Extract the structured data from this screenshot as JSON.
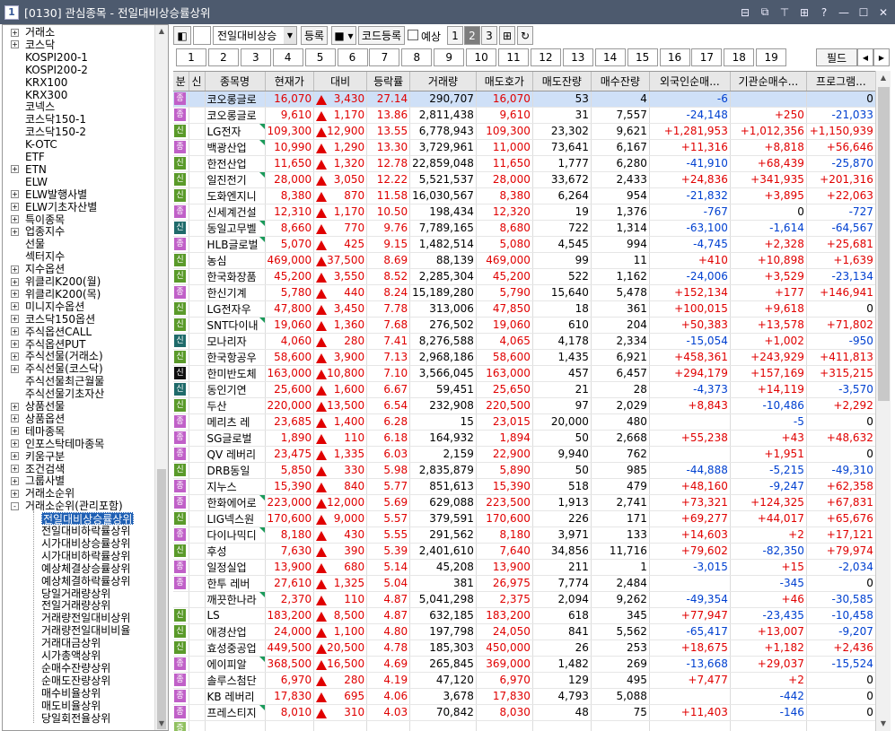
{
  "window": {
    "icon": "1",
    "title": "[0130] 관심종목 - 전일대비상승률상위"
  },
  "tree": [
    {
      "label": "거래소",
      "exp": "+"
    },
    {
      "label": "코스닥",
      "exp": "+"
    },
    {
      "label": "KOSPI200-1"
    },
    {
      "label": "KOSPI200-2"
    },
    {
      "label": "KRX100"
    },
    {
      "label": "KRX300"
    },
    {
      "label": "코넥스"
    },
    {
      "label": "코스닥150-1"
    },
    {
      "label": "코스닥150-2"
    },
    {
      "label": "K-OTC"
    },
    {
      "label": "ETF"
    },
    {
      "label": "ETN",
      "exp": "+"
    },
    {
      "label": "ELW"
    },
    {
      "label": "ELW발행사별",
      "exp": "+"
    },
    {
      "label": "ELW기초자산별",
      "exp": "+"
    },
    {
      "label": "특이종목",
      "exp": "+"
    },
    {
      "label": "업종지수",
      "exp": "+"
    },
    {
      "label": "선물"
    },
    {
      "label": "섹터지수"
    },
    {
      "label": "지수옵션",
      "exp": "+"
    },
    {
      "label": "위클리K200(월)",
      "exp": "+"
    },
    {
      "label": "위클리K200(목)",
      "exp": "+"
    },
    {
      "label": "미니지수옵션",
      "exp": "+"
    },
    {
      "label": "코스닥150옵션",
      "exp": "+"
    },
    {
      "label": "주식옵션CALL",
      "exp": "+"
    },
    {
      "label": "주식옵션PUT",
      "exp": "+"
    },
    {
      "label": "주식선물(거래소)",
      "exp": "+"
    },
    {
      "label": "주식선물(코스닥)",
      "exp": "+"
    },
    {
      "label": "주식선물최근월물"
    },
    {
      "label": "주식선물기초자산"
    },
    {
      "label": "상품선물",
      "exp": "+"
    },
    {
      "label": "상품옵션",
      "exp": "+"
    },
    {
      "label": "테마종목",
      "exp": "+"
    },
    {
      "label": "인포스탁테마종목",
      "exp": "+"
    },
    {
      "label": "키움구분",
      "exp": "+"
    },
    {
      "label": "조건검색",
      "exp": "+"
    },
    {
      "label": "그룹사별",
      "exp": "+"
    },
    {
      "label": "거래소순위",
      "exp": "+"
    },
    {
      "label": "거래소순위(관리포함)",
      "exp": "-"
    },
    {
      "label": "전일대비상승률상위",
      "child": true,
      "selected": true
    },
    {
      "label": "전일대비하락률상위",
      "child": true
    },
    {
      "label": "시가대비상승률상위",
      "child": true
    },
    {
      "label": "시가대비하락률상위",
      "child": true
    },
    {
      "label": "예상체결상승률상위",
      "child": true
    },
    {
      "label": "예상체결하락률상위",
      "child": true
    },
    {
      "label": "당일거래량상위",
      "child": true
    },
    {
      "label": "전일거래량상위",
      "child": true
    },
    {
      "label": "거래량전일대비상위",
      "child": true
    },
    {
      "label": "거래량전일대비비율",
      "child": true
    },
    {
      "label": "거래대금상위",
      "child": true
    },
    {
      "label": "시가총액상위",
      "child": true
    },
    {
      "label": "순매수잔량상위",
      "child": true
    },
    {
      "label": "순매도잔량상위",
      "child": true
    },
    {
      "label": "매수비율상위",
      "child": true
    },
    {
      "label": "매도비율상위",
      "child": true
    },
    {
      "label": "당일회전율상위",
      "child": true
    }
  ],
  "toolbar": {
    "group_select": "전일대비상승",
    "register": "등록",
    "code_register": "코드등록",
    "expected_label": "예상",
    "pages": [
      "1",
      "2",
      "3"
    ],
    "current_page": "2"
  },
  "num_tabs": [
    "1",
    "2",
    "3",
    "4",
    "5",
    "6",
    "7",
    "8",
    "9",
    "10",
    "11",
    "12",
    "13",
    "14",
    "15",
    "16",
    "17",
    "18",
    "19"
  ],
  "field_button": "필드",
  "columns": [
    "분",
    "신",
    "종목명",
    "현재가",
    "대비",
    "등락률",
    "거래량",
    "매도호가",
    "매도잔량",
    "매수잔량",
    "외국인순매...",
    "기관순매수...",
    "프로그램..."
  ],
  "tag_colors": {
    "종": "#c060c8",
    "신": "#5a9a2a",
    "신D": "#1f6a6a",
    "신B": "#101010",
    "증": "#90c060"
  },
  "rows": [
    {
      "t": "종",
      "n": "코오롱글로",
      "p": "16,070",
      "d": "3,430",
      "up": true,
      "r": "27.14",
      "v": "290,707",
      "a": "16,070",
      "as": "53",
      "bs": "4",
      "f": "-6",
      "i": "",
      "g": "0",
      "hl": true
    },
    {
      "t": "종",
      "n": "코오롱글로",
      "p": "9,610",
      "d": "1,170",
      "r": "13.86",
      "v": "2,811,438",
      "a": "9,610",
      "as": "31",
      "bs": "7,557",
      "f": "-24,148",
      "i": "+250",
      "g": "-21,033"
    },
    {
      "t": "신",
      "n": "LG전자",
      "p": "109,300",
      "d": "12,900",
      "r": "13.55",
      "v": "6,778,943",
      "a": "109,300",
      "as": "23,302",
      "bs": "9,621",
      "f": "+1,281,953",
      "i": "+1,012,356",
      "g": "+1,150,939",
      "c": true
    },
    {
      "t": "종",
      "n": "백광산업",
      "p": "10,990",
      "d": "1,290",
      "r": "13.30",
      "v": "3,729,961",
      "a": "11,000",
      "as": "73,641",
      "bs": "6,167",
      "f": "+11,316",
      "i": "+8,818",
      "g": "+56,646",
      "c": true
    },
    {
      "t": "신",
      "n": "한전산업",
      "p": "11,650",
      "d": "1,320",
      "r": "12.78",
      "v": "22,859,048",
      "a": "11,650",
      "as": "1,777",
      "bs": "6,280",
      "f": "-41,910",
      "i": "+68,439",
      "g": "-25,870"
    },
    {
      "t": "신",
      "n": "일진전기",
      "p": "28,000",
      "d": "3,050",
      "r": "12.22",
      "v": "5,521,537",
      "a": "28,000",
      "as": "33,672",
      "bs": "2,433",
      "f": "+24,836",
      "i": "+341,935",
      "g": "+201,316",
      "c": true
    },
    {
      "t": "신",
      "n": "도화엔지니",
      "p": "8,380",
      "d": "870",
      "r": "11.58",
      "v": "16,030,567",
      "a": "8,380",
      "as": "6,264",
      "bs": "954",
      "f": "-21,832",
      "i": "+3,895",
      "g": "+22,063"
    },
    {
      "t": "종",
      "n": "신세계건설",
      "p": "12,310",
      "d": "1,170",
      "r": "10.50",
      "v": "198,434",
      "a": "12,320",
      "as": "19",
      "bs": "1,376",
      "f": "-767",
      "i": "0",
      "g": "-727"
    },
    {
      "t": "신D",
      "n": "동일고무벨",
      "p": "8,660",
      "d": "770",
      "r": "9.76",
      "v": "7,789,165",
      "a": "8,680",
      "as": "722",
      "bs": "1,314",
      "f": "-63,100",
      "i": "-1,614",
      "g": "-64,567",
      "c": true
    },
    {
      "t": "종",
      "n": "HLB글로벌",
      "p": "5,070",
      "d": "425",
      "r": "9.15",
      "v": "1,482,514",
      "a": "5,080",
      "as": "4,545",
      "bs": "994",
      "f": "-4,745",
      "i": "+2,328",
      "g": "+25,681",
      "c": true
    },
    {
      "t": "신",
      "n": "농심",
      "p": "469,000",
      "d": "37,500",
      "r": "8.69",
      "v": "88,139",
      "a": "469,000",
      "as": "99",
      "bs": "11",
      "f": "+410",
      "i": "+10,898",
      "g": "+1,639"
    },
    {
      "t": "신",
      "n": "한국화장품",
      "p": "45,200",
      "d": "3,550",
      "r": "8.52",
      "v": "2,285,304",
      "a": "45,200",
      "as": "522",
      "bs": "1,162",
      "f": "-24,006",
      "i": "+3,529",
      "g": "-23,134"
    },
    {
      "t": "종",
      "n": "한신기계",
      "p": "5,780",
      "d": "440",
      "r": "8.24",
      "v": "15,189,280",
      "a": "5,790",
      "as": "15,640",
      "bs": "5,478",
      "f": "+152,134",
      "i": "+177",
      "g": "+146,941"
    },
    {
      "t": "신",
      "n": "LG전자우",
      "p": "47,800",
      "d": "3,450",
      "r": "7.78",
      "v": "313,006",
      "a": "47,850",
      "as": "18",
      "bs": "361",
      "f": "+100,015",
      "i": "+9,618",
      "g": "0"
    },
    {
      "t": "신",
      "n": "SNT다이내",
      "p": "19,060",
      "d": "1,360",
      "r": "7.68",
      "v": "276,502",
      "a": "19,060",
      "as": "610",
      "bs": "204",
      "f": "+50,383",
      "i": "+13,578",
      "g": "+71,802",
      "c": true
    },
    {
      "t": "신D",
      "n": "모나리자",
      "p": "4,060",
      "d": "280",
      "r": "7.41",
      "v": "8,276,588",
      "a": "4,065",
      "as": "4,178",
      "bs": "2,334",
      "f": "-15,054",
      "i": "+1,002",
      "g": "-950"
    },
    {
      "t": "신",
      "n": "한국항공우",
      "p": "58,600",
      "d": "3,900",
      "r": "7.13",
      "v": "2,968,186",
      "a": "58,600",
      "as": "1,435",
      "bs": "6,921",
      "f": "+458,361",
      "i": "+243,929",
      "g": "+411,813"
    },
    {
      "t": "신B",
      "n": "한미반도체",
      "p": "163,000",
      "d": "10,800",
      "r": "7.10",
      "v": "3,566,045",
      "a": "163,000",
      "as": "457",
      "bs": "6,457",
      "f": "+294,179",
      "i": "+157,169",
      "g": "+315,215"
    },
    {
      "t": "신D",
      "n": "동인기연",
      "p": "25,600",
      "d": "1,600",
      "r": "6.67",
      "v": "59,451",
      "a": "25,650",
      "as": "21",
      "bs": "28",
      "f": "-4,373",
      "i": "+14,119",
      "g": "-3,570"
    },
    {
      "t": "신",
      "n": "두산",
      "p": "220,000",
      "d": "13,500",
      "r": "6.54",
      "v": "232,908",
      "a": "220,500",
      "as": "97",
      "bs": "2,029",
      "f": "+8,843",
      "i": "-10,486",
      "g": "+2,292"
    },
    {
      "t": "종",
      "n": "메리츠 레",
      "p": "23,685",
      "d": "1,400",
      "r": "6.28",
      "v": "15",
      "a": "23,015",
      "as": "20,000",
      "bs": "480",
      "f": "",
      "i": "-5",
      "g": "0"
    },
    {
      "t": "종",
      "n": "SG글로벌",
      "p": "1,890",
      "d": "110",
      "r": "6.18",
      "v": "164,932",
      "a": "1,894",
      "as": "50",
      "bs": "2,668",
      "f": "+55,238",
      "i": "+43",
      "g": "+48,632"
    },
    {
      "t": "종",
      "n": "QV 레버리",
      "p": "23,475",
      "d": "1,335",
      "r": "6.03",
      "v": "2,159",
      "a": "22,900",
      "as": "9,940",
      "bs": "762",
      "f": "",
      "i": "+1,951",
      "g": "0"
    },
    {
      "t": "신",
      "n": "DRB동일",
      "p": "5,850",
      "d": "330",
      "r": "5.98",
      "v": "2,835,879",
      "a": "5,890",
      "as": "50",
      "bs": "985",
      "f": "-44,888",
      "i": "-5,215",
      "g": "-49,310"
    },
    {
      "t": "종",
      "n": "지누스",
      "p": "15,390",
      "d": "840",
      "r": "5.77",
      "v": "851,613",
      "a": "15,390",
      "as": "518",
      "bs": "479",
      "f": "+48,160",
      "i": "-9,247",
      "g": "+62,358"
    },
    {
      "t": "종",
      "n": "한화에어로",
      "p": "223,000",
      "d": "12,000",
      "r": "5.69",
      "v": "629,088",
      "a": "223,500",
      "as": "1,913",
      "bs": "2,741",
      "f": "+73,321",
      "i": "+124,325",
      "g": "+67,831",
      "c": true
    },
    {
      "t": "신",
      "n": "LIG넥스원",
      "p": "170,600",
      "d": "9,000",
      "r": "5.57",
      "v": "379,591",
      "a": "170,600",
      "as": "226",
      "bs": "171",
      "f": "+69,277",
      "i": "+44,017",
      "g": "+65,676"
    },
    {
      "t": "종",
      "n": "다이나믹디",
      "p": "8,180",
      "d": "430",
      "r": "5.55",
      "v": "291,562",
      "a": "8,180",
      "as": "3,971",
      "bs": "133",
      "f": "+14,603",
      "i": "+2",
      "g": "+17,121",
      "c": true
    },
    {
      "t": "신",
      "n": "후성",
      "p": "7,630",
      "d": "390",
      "r": "5.39",
      "v": "2,401,610",
      "a": "7,640",
      "as": "34,856",
      "bs": "11,716",
      "f": "+79,602",
      "i": "-82,350",
      "g": "+79,974"
    },
    {
      "t": "종",
      "n": "일정실업",
      "p": "13,900",
      "d": "680",
      "r": "5.14",
      "v": "45,208",
      "a": "13,900",
      "as": "211",
      "bs": "1",
      "f": "-3,015",
      "i": "+15",
      "g": "-2,034"
    },
    {
      "t": "종",
      "n": "한투 레버",
      "p": "27,610",
      "d": "1,325",
      "r": "5.04",
      "v": "381",
      "a": "26,975",
      "as": "7,774",
      "bs": "2,484",
      "f": "",
      "i": "-345",
      "g": "0"
    },
    {
      "t": "",
      "n": "깨끗한나라",
      "p": "2,370",
      "d": "110",
      "r": "4.87",
      "v": "5,041,298",
      "a": "2,375",
      "as": "2,094",
      "bs": "9,262",
      "f": "-49,354",
      "i": "+46",
      "g": "-30,585",
      "c": true
    },
    {
      "t": "신",
      "n": "LS",
      "p": "183,200",
      "d": "8,500",
      "r": "4.87",
      "v": "632,185",
      "a": "183,200",
      "as": "618",
      "bs": "345",
      "f": "+77,947",
      "i": "-23,435",
      "g": "-10,458"
    },
    {
      "t": "신",
      "n": "애경산업",
      "p": "24,000",
      "d": "1,100",
      "r": "4.80",
      "v": "197,798",
      "a": "24,050",
      "as": "841",
      "bs": "5,562",
      "f": "-65,417",
      "i": "+13,007",
      "g": "-9,207"
    },
    {
      "t": "신",
      "n": "효성중공업",
      "p": "449,500",
      "d": "20,500",
      "r": "4.78",
      "v": "185,303",
      "a": "450,000",
      "as": "26",
      "bs": "253",
      "f": "+18,675",
      "i": "+1,182",
      "g": "+2,436"
    },
    {
      "t": "종",
      "n": "에이피알",
      "p": "368,500",
      "d": "16,500",
      "r": "4.69",
      "v": "265,845",
      "a": "369,000",
      "as": "1,482",
      "bs": "269",
      "f": "-13,668",
      "i": "+29,037",
      "g": "-15,524",
      "c": true
    },
    {
      "t": "종",
      "n": "솔루스첨단",
      "p": "6,970",
      "d": "280",
      "r": "4.19",
      "v": "47,120",
      "a": "6,970",
      "as": "129",
      "bs": "495",
      "f": "+7,477",
      "i": "+2",
      "g": "0"
    },
    {
      "t": "종",
      "n": "KB 레버리",
      "p": "17,830",
      "d": "695",
      "r": "4.06",
      "v": "3,678",
      "a": "17,830",
      "as": "4,793",
      "bs": "5,088",
      "f": "",
      "i": "-442",
      "g": "0"
    },
    {
      "t": "종",
      "n": "프레스티지",
      "p": "8,010",
      "d": "310",
      "r": "4.03",
      "v": "70,842",
      "a": "8,030",
      "as": "48",
      "bs": "75",
      "f": "+11,403",
      "i": "-146",
      "g": "0",
      "c": true
    },
    {
      "t": "증",
      "n": "",
      "p": "",
      "d": "",
      "r": "",
      "v": "",
      "a": "",
      "as": "",
      "bs": "",
      "f": "",
      "i": "",
      "g": ""
    }
  ]
}
